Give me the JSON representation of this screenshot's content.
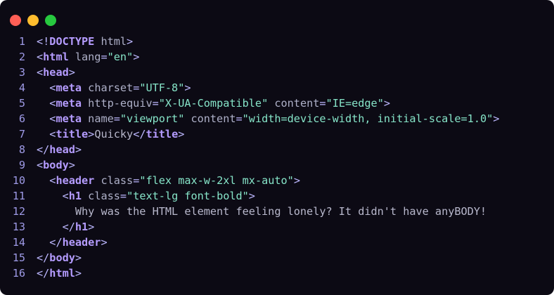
{
  "window": {
    "traffic_lights": [
      {
        "name": "close",
        "color": "#ff5f56"
      },
      {
        "name": "minimize",
        "color": "#ffbd2e"
      },
      {
        "name": "zoom",
        "color": "#27c93f"
      }
    ]
  },
  "lines": [
    {
      "n": "1",
      "indent": "",
      "tokens": [
        {
          "c": "p",
          "v": "<!"
        },
        {
          "c": "t",
          "v": "DOCTYPE"
        },
        {
          "c": "a",
          "v": " html"
        },
        {
          "c": "p",
          "v": ">"
        }
      ]
    },
    {
      "n": "2",
      "indent": "",
      "tokens": [
        {
          "c": "p",
          "v": "<"
        },
        {
          "c": "t",
          "v": "html"
        },
        {
          "c": "a",
          "v": " lang"
        },
        {
          "c": "p",
          "v": "="
        },
        {
          "c": "s",
          "v": "\"en\""
        },
        {
          "c": "p",
          "v": ">"
        }
      ]
    },
    {
      "n": "3",
      "indent": "",
      "tokens": [
        {
          "c": "p",
          "v": "<"
        },
        {
          "c": "t",
          "v": "head"
        },
        {
          "c": "p",
          "v": ">"
        }
      ]
    },
    {
      "n": "4",
      "indent": "  ",
      "tokens": [
        {
          "c": "p",
          "v": "<"
        },
        {
          "c": "t",
          "v": "meta"
        },
        {
          "c": "a",
          "v": " charset"
        },
        {
          "c": "p",
          "v": "="
        },
        {
          "c": "s",
          "v": "\"UTF-8\""
        },
        {
          "c": "p",
          "v": ">"
        }
      ]
    },
    {
      "n": "5",
      "indent": "  ",
      "tokens": [
        {
          "c": "p",
          "v": "<"
        },
        {
          "c": "t",
          "v": "meta"
        },
        {
          "c": "a",
          "v": " http-equiv"
        },
        {
          "c": "p",
          "v": "="
        },
        {
          "c": "s",
          "v": "\"X-UA-Compatible\""
        },
        {
          "c": "a",
          "v": " content"
        },
        {
          "c": "p",
          "v": "="
        },
        {
          "c": "s",
          "v": "\"IE=edge\""
        },
        {
          "c": "p",
          "v": ">"
        }
      ]
    },
    {
      "n": "6",
      "indent": "  ",
      "tokens": [
        {
          "c": "p",
          "v": "<"
        },
        {
          "c": "t",
          "v": "meta"
        },
        {
          "c": "a",
          "v": " name"
        },
        {
          "c": "p",
          "v": "="
        },
        {
          "c": "s",
          "v": "\"viewport\""
        },
        {
          "c": "a",
          "v": " content"
        },
        {
          "c": "p",
          "v": "="
        },
        {
          "c": "s",
          "v": "\"width=device-width, initial-scale=1.0\""
        },
        {
          "c": "p",
          "v": ">"
        }
      ]
    },
    {
      "n": "7",
      "indent": "  ",
      "tokens": [
        {
          "c": "p",
          "v": "<"
        },
        {
          "c": "t",
          "v": "title"
        },
        {
          "c": "p",
          "v": ">"
        },
        {
          "c": "x",
          "v": "Quicky"
        },
        {
          "c": "p",
          "v": "</"
        },
        {
          "c": "t",
          "v": "title"
        },
        {
          "c": "p",
          "v": ">"
        }
      ]
    },
    {
      "n": "8",
      "indent": "",
      "tokens": [
        {
          "c": "p",
          "v": "</"
        },
        {
          "c": "t",
          "v": "head"
        },
        {
          "c": "p",
          "v": ">"
        }
      ]
    },
    {
      "n": "9",
      "indent": "",
      "tokens": [
        {
          "c": "p",
          "v": "<"
        },
        {
          "c": "t",
          "v": "body"
        },
        {
          "c": "p",
          "v": ">"
        }
      ]
    },
    {
      "n": "10",
      "indent": "  ",
      "tokens": [
        {
          "c": "p",
          "v": "<"
        },
        {
          "c": "t",
          "v": "header"
        },
        {
          "c": "a",
          "v": " class"
        },
        {
          "c": "p",
          "v": "="
        },
        {
          "c": "s",
          "v": "\"flex max-w-2xl mx-auto\""
        },
        {
          "c": "p",
          "v": ">"
        }
      ]
    },
    {
      "n": "11",
      "indent": "    ",
      "tokens": [
        {
          "c": "p",
          "v": "<"
        },
        {
          "c": "t",
          "v": "h1"
        },
        {
          "c": "a",
          "v": " class"
        },
        {
          "c": "p",
          "v": "="
        },
        {
          "c": "s",
          "v": "\"text-lg font-bold\""
        },
        {
          "c": "p",
          "v": ">"
        }
      ]
    },
    {
      "n": "12",
      "indent": "      ",
      "tokens": [
        {
          "c": "x",
          "v": "Why was the HTML element feeling lonely? It didn't have anyBODY!"
        }
      ]
    },
    {
      "n": "13",
      "indent": "    ",
      "tokens": [
        {
          "c": "p",
          "v": "</"
        },
        {
          "c": "t",
          "v": "h1"
        },
        {
          "c": "p",
          "v": ">"
        }
      ]
    },
    {
      "n": "14",
      "indent": "  ",
      "tokens": [
        {
          "c": "p",
          "v": "</"
        },
        {
          "c": "t",
          "v": "header"
        },
        {
          "c": "p",
          "v": ">"
        }
      ]
    },
    {
      "n": "15",
      "indent": "",
      "tokens": [
        {
          "c": "p",
          "v": "</"
        },
        {
          "c": "t",
          "v": "body"
        },
        {
          "c": "p",
          "v": ">"
        }
      ]
    },
    {
      "n": "16",
      "indent": "",
      "tokens": [
        {
          "c": "p",
          "v": "</"
        },
        {
          "c": "t",
          "v": "html"
        },
        {
          "c": "p",
          "v": ">"
        }
      ]
    }
  ]
}
